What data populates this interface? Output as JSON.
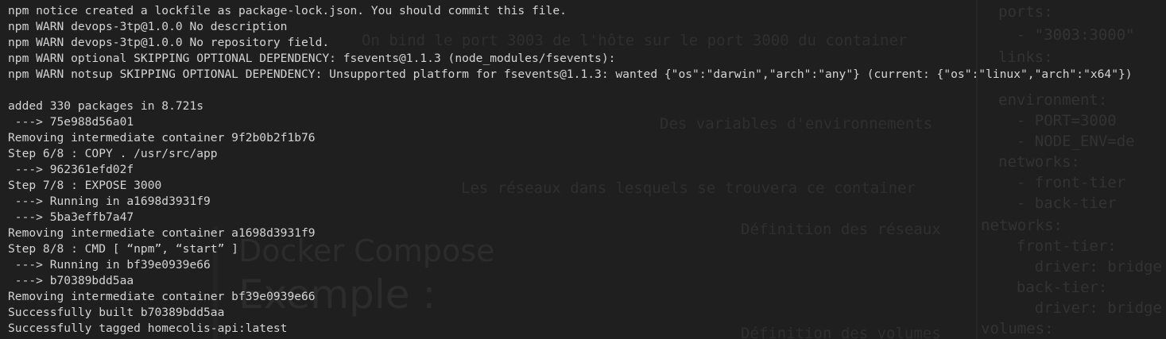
{
  "terminal_lines": [
    "npm notice created a lockfile as package-lock.json. You should commit this file.",
    "npm WARN devops-3tp@1.0.0 No description",
    "npm WARN devops-3tp@1.0.0 No repository field.",
    "npm WARN optional SKIPPING OPTIONAL DEPENDENCY: fsevents@1.1.3 (node_modules/fsevents):",
    "npm WARN notsup SKIPPING OPTIONAL DEPENDENCY: Unsupported platform for fsevents@1.1.3: wanted {\"os\":\"darwin\",\"arch\":\"any\"} (current: {\"os\":\"linux\",\"arch\":\"x64\"})",
    "",
    "added 330 packages in 8.721s",
    " ---> 75e988d56a01",
    "Removing intermediate container 9f2b0b2f1b76",
    "Step 6/8 : COPY . /usr/src/app",
    " ---> 962361efd02f",
    "Step 7/8 : EXPOSE 3000",
    " ---> Running in a1698d3931f9",
    " ---> 5ba3effb7a47",
    "Removing intermediate container a1698d3931f9",
    "Step 8/8 : CMD [ “npm”, “start” ]",
    " ---> Running in bf39e0939e66",
    " ---> b70389bdd5aa",
    "Removing intermediate container bf39e0939e66",
    "Successfully built b70389bdd5aa",
    "Successfully tagged homecolis-api:latest"
  ],
  "background_slide": {
    "heading": "Docker Compose",
    "subheading": "Exemple :",
    "annotations": [
      "On bind le port 3003 de l'hôte sur le port 3000 du container",
      "Des variables d'environnements",
      "Les réseaux dans lesquels se trouvera ce container",
      "Définition des réseaux",
      "Définition des volumes"
    ],
    "code_lines": [
      "ports:",
      "  - \"3003:3000\"",
      "links:",
      "environment:",
      "  - PORT=3000",
      "  - NODE_ENV=de",
      "networks:",
      "  - front-tier",
      "  - back-tier",
      "networks:",
      "  front-tier:",
      "    driver: bridge",
      "  back-tier:",
      "    driver: bridge",
      "volumes:"
    ]
  }
}
